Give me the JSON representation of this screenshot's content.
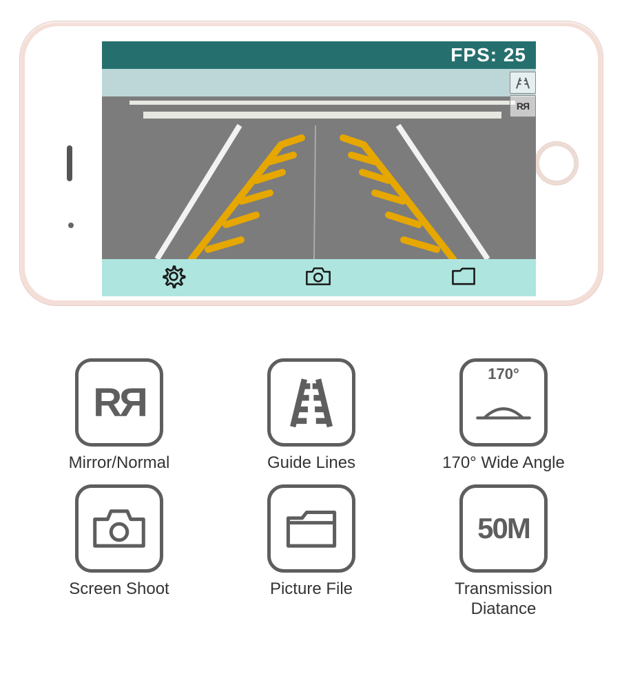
{
  "phone": {
    "fps_label": "FPS: 25",
    "overlay": {
      "mirror_icon": "RЯ"
    },
    "toolbar": {
      "settings_icon": "gear-icon",
      "capture_icon": "camera-icon",
      "files_icon": "folder-icon"
    }
  },
  "features": [
    {
      "id": "mirror-normal",
      "icon_text": "RЯ",
      "label": "Mirror/Normal"
    },
    {
      "id": "guide-lines",
      "label": "Guide Lines"
    },
    {
      "id": "wide-angle",
      "angle_text": "170°",
      "label": "170° Wide Angle"
    },
    {
      "id": "screen-shoot",
      "label": "Screen Shoot"
    },
    {
      "id": "picture-file",
      "label": "Picture File"
    },
    {
      "id": "transmission",
      "distance_text": "50M",
      "label": "Transmission Diatance"
    }
  ]
}
